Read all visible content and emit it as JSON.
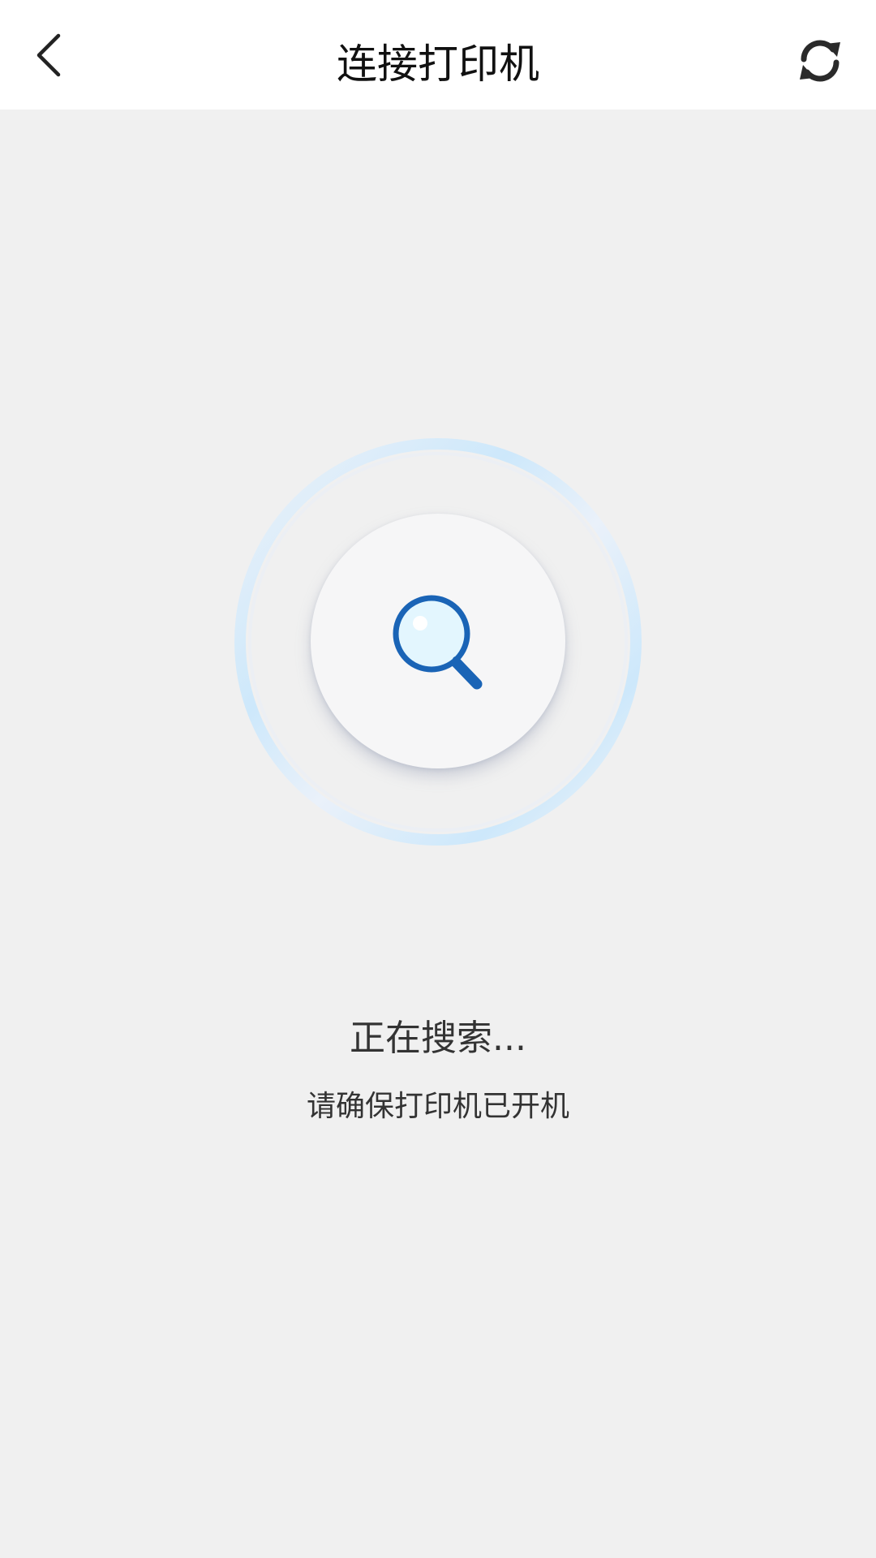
{
  "header": {
    "title": "连接打印机",
    "back_icon": "chevron-left-icon",
    "refresh_icon": "refresh-icon"
  },
  "search": {
    "icon": "search-icon",
    "status": "正在搜索...",
    "hint": "请确保打印机已开机"
  },
  "colors": {
    "background": "#f0f0f0",
    "header_bg": "#ffffff",
    "text_primary": "#333333",
    "accent_blue": "#1a64b6",
    "ring_blue": "#c7e6fb"
  }
}
